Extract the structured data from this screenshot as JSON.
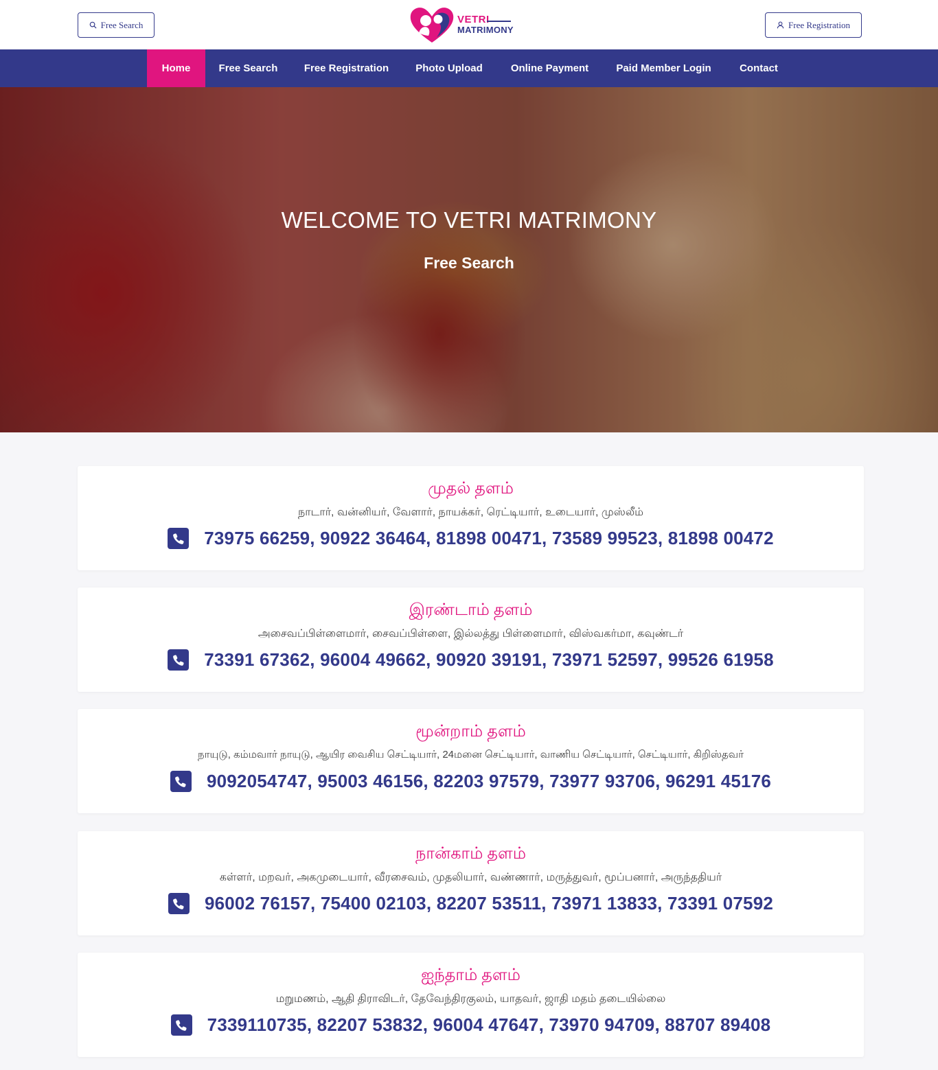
{
  "header": {
    "free_search_label": "Free Search",
    "free_registration_label": "Free Registration",
    "logo_line1": "VETRI",
    "logo_line2": "MATRIMONY"
  },
  "nav": {
    "items": [
      {
        "label": "Home",
        "active": true
      },
      {
        "label": "Free Search"
      },
      {
        "label": "Free Registration"
      },
      {
        "label": "Photo Upload"
      },
      {
        "label": "Online Payment"
      },
      {
        "label": "Paid Member Login"
      },
      {
        "label": "Contact"
      }
    ]
  },
  "hero": {
    "title": "WELCOME TO VETRI MATRIMONY",
    "subtitle": "Free Search"
  },
  "cards": [
    {
      "title": "முதல் தளம்",
      "castes": "நாடார், வன்னியர், வேளார், நாயக்கர், ரெட்டியார், உடையார், முஸ்லீம்",
      "phones": "73975 66259, 90922 36464, 81898 00471, 73589 99523, 81898 00472"
    },
    {
      "title": "இரண்டாம் தளம்",
      "castes": "அசைவப்பிள்ளைமார், சைவப்பிள்ளை, இல்லத்து பிள்ளைமார், விஸ்வகர்மா, கவுண்டர்",
      "phones": "73391 67362, 96004 49662, 90920 39191, 73971 52597, 99526 61958"
    },
    {
      "title": "மூன்றாம் தளம்",
      "castes": "நாயுடு, கம்மவார் நாயுடு, ஆயிர வைசிய செட்டியார், 24மனை செட்டியார், வாணிய செட்டியார், செட்டியார், கிறிஸ்தவர்",
      "phones": "9092054747, 95003 46156, 82203 97579, 73977 93706, 96291 45176"
    },
    {
      "title": "நான்காம் தளம்",
      "castes": "கள்ளர், மறவர், அகமுடையார், வீரசைவம், முதலியார், வண்ணார், மருத்துவர், மூப்பனார், அருந்ததியர்",
      "phones": "96002 76157, 75400 02103, 82207 53511, 73971 13833, 73391 07592"
    },
    {
      "title": "ஐந்தாம் தளம்",
      "castes": "மறுமணம், ஆதி திராவிடர், தேவேந்திரகுலம், யாதவர், ஜாதி மதம் தடையில்லை",
      "phones": "7339110735, 82207 53832, 96004 47647, 73970 94709, 88707 89408"
    }
  ],
  "colors": {
    "brand_blue": "#33398a",
    "brand_pink": "#e0157f",
    "page_bg": "#f6f6f9"
  },
  "icons": {
    "search": "search-icon",
    "user": "user-icon",
    "phone": "phone-icon",
    "logo": "heart-couple-logo-icon"
  }
}
